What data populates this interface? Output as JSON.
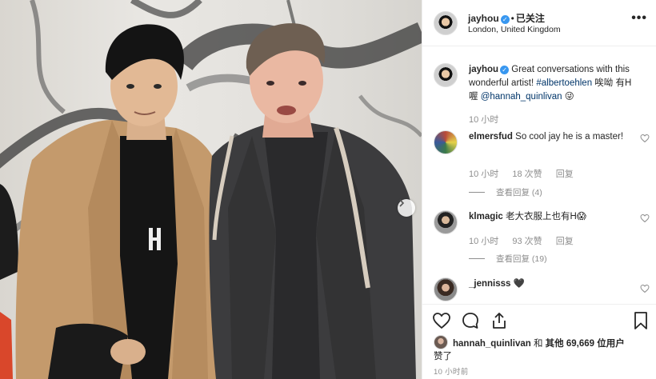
{
  "post": {
    "username": "jayhou",
    "location": "London, United Kingdom",
    "follow_status": "已关注",
    "caption_user": "jayhou",
    "caption_text": "Great conversations with this wonderful artist!",
    "caption_hashtag": "#albertoehlen",
    "caption_extra": "唉呦 有H喔",
    "caption_mention": "@hannah_quinlivan",
    "caption_emoji": "😜",
    "caption_time": "10 小时"
  },
  "comments": [
    {
      "user": "elmersfud",
      "text": "So cool jay he is a master!",
      "time": "10 小时",
      "likes": "18 次赞",
      "reply": "回复",
      "view_replies": "查看回复 (4)"
    },
    {
      "user": "klmagic",
      "text": "老大衣服上也有H😱",
      "time": "10 小时",
      "likes": "93 次赞",
      "reply": "回复",
      "view_replies": "查看回复 (19)"
    },
    {
      "user": "_jennisss",
      "text": "🖤"
    }
  ],
  "likes_line": {
    "user": "hannah_quinlivan",
    "connector": "和",
    "others": "其他 69,669 位用户",
    "suffix": "赞了"
  },
  "timestamp": "10 小时前",
  "icons": {
    "more": "more-options-icon",
    "verified": "verified-badge-icon",
    "heart": "heart-icon",
    "comment": "comment-icon",
    "share": "share-icon",
    "save": "bookmark-icon",
    "next": "chevron-right-icon"
  },
  "colors": {
    "link": "#003569",
    "verified": "#3897f0",
    "muted": "#8e8e8e",
    "text": "#262626"
  }
}
